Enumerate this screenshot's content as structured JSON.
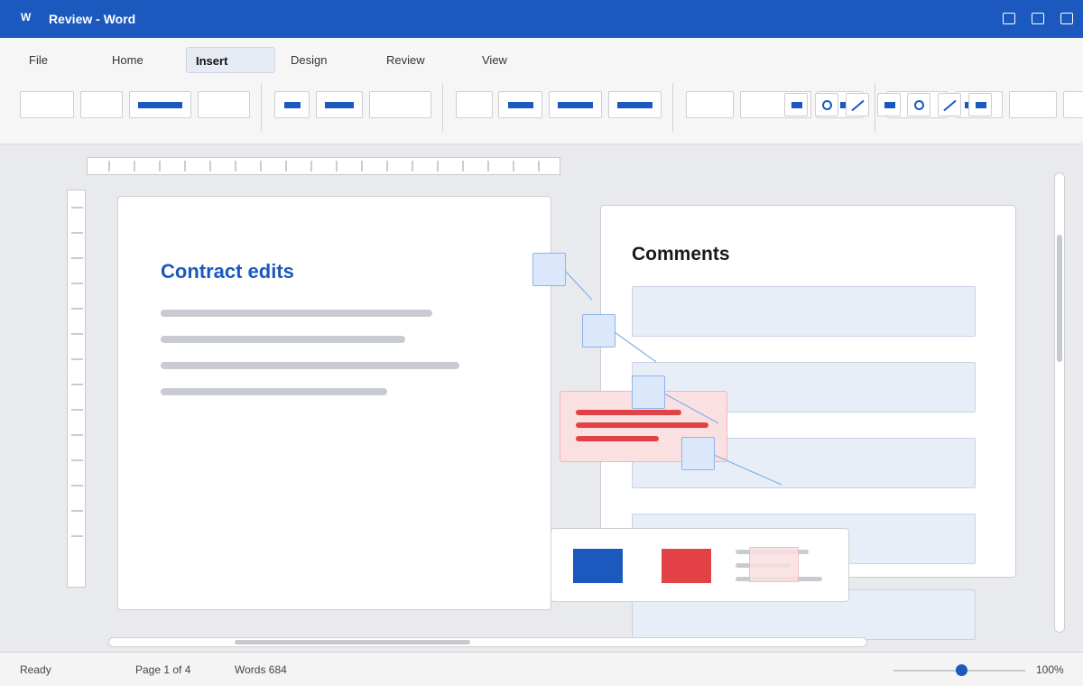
{
  "app": {
    "logo": "W",
    "title": "Review - Word"
  },
  "ribbon": {
    "tabs": [
      {
        "label": "File",
        "active": false
      },
      {
        "label": "Home",
        "active": false
      },
      {
        "label": "Insert",
        "active": true
      },
      {
        "label": "Design",
        "active": false
      },
      {
        "label": "Review",
        "active": false
      },
      {
        "label": "View",
        "active": false
      }
    ]
  },
  "document": {
    "title": "Contract edits"
  },
  "comments": {
    "title": "Comments"
  },
  "status": {
    "state": "Ready",
    "page": "Page 1 of 4",
    "words": "Words 684",
    "zoom_label": "100%",
    "zoom_level": 0.52
  },
  "colors": {
    "accent": "#1b59be",
    "deletion": "#e24146",
    "deletion_bg": "#fbe0e1",
    "comment_bg": "#e8eef8"
  },
  "icons": [
    "rectangle-icon",
    "circle-icon",
    "line-icon"
  ]
}
